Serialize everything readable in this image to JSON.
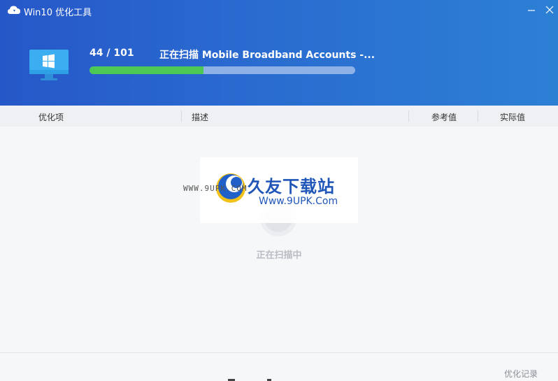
{
  "window": {
    "title": "Win10 优化工具",
    "icons": {
      "app": "cloud-icon",
      "minimize": "minimize-icon",
      "close": "close-icon"
    }
  },
  "scan": {
    "count": "44 / 101",
    "status": "正在扫描 Mobile Broadband Accounts -...",
    "progress": 0.43,
    "icon": "monitor-windows-icon"
  },
  "table": {
    "columns": [
      "优化项",
      "描述",
      "参考值",
      "实际值"
    ]
  },
  "watermark": {
    "small_text": "WWW.9UPK.COM",
    "brand": "久友下载站",
    "url": "Www.9UPK.Com"
  },
  "body": {
    "scanning_label": "正在扫描中"
  },
  "footer": {
    "history_label": "优化记录"
  },
  "colors": {
    "header_start": "#2657c8",
    "header_end": "#2c80d4",
    "progress_fill": "#4cc854",
    "progress_track": "#8fb2e6"
  }
}
